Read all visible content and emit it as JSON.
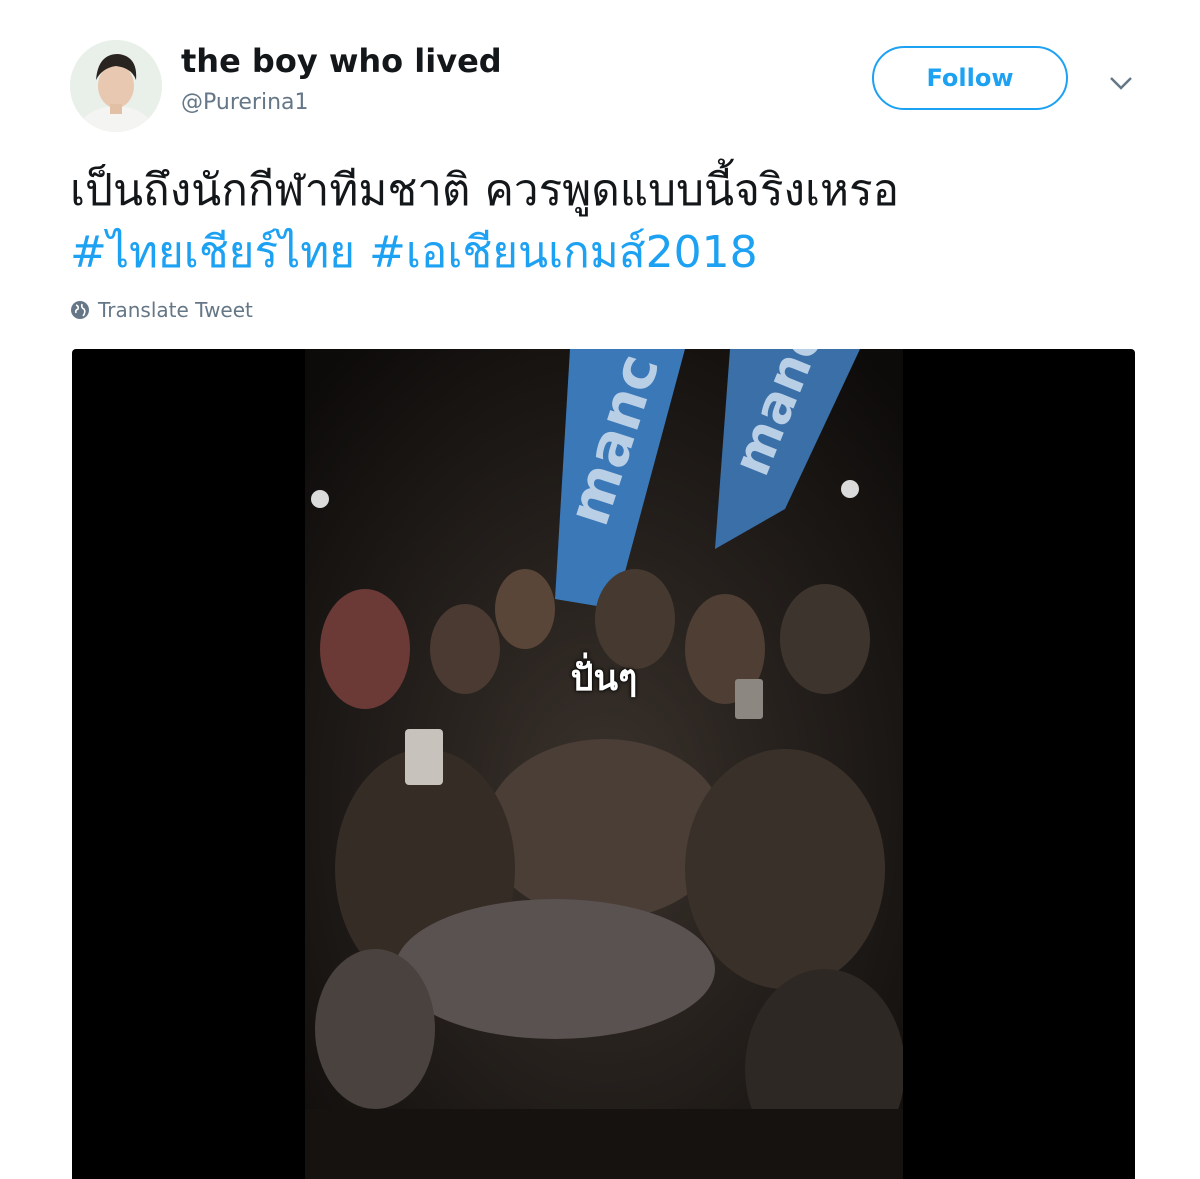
{
  "user": {
    "display_name": "the boy who lived",
    "handle": "@Purerina1",
    "avatar_icon": "profile-photo"
  },
  "follow_label": "Follow",
  "menu_icon": "chevron-down-icon",
  "tweet": {
    "text": "เป็นถึงนักกีฬาทีมชาติ ควรพูดแบบนี้จริงเหรอ",
    "hashtags": [
      "#ไทยเชียร์ไทย",
      "#เอเชียนเกมส์2018"
    ]
  },
  "translate_label": "Translate Tweet",
  "media": {
    "caption": "ปั่นๆ",
    "banner_text": "manc"
  },
  "colors": {
    "accent": "#1da1f2",
    "text": "#14171a",
    "muted": "#657786",
    "media_background": "#000000"
  }
}
